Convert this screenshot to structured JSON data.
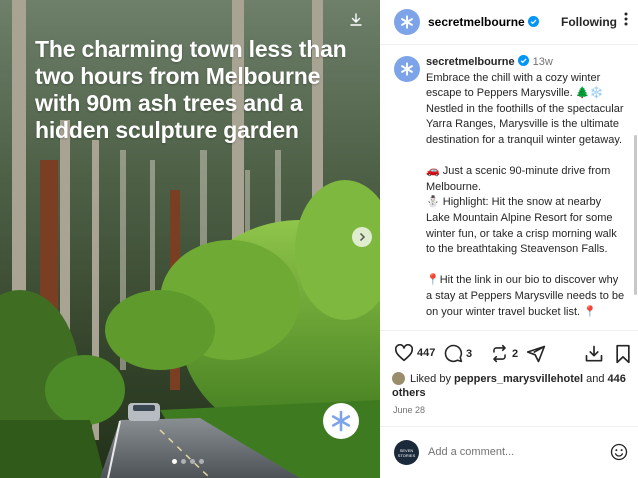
{
  "post": {
    "headline": "The charming town less than two hours from Melbourne with 90m ash trees and a hidden sculpture garden",
    "carousel_total": 4,
    "carousel_active": 1
  },
  "header": {
    "username": "secretmelbourne",
    "follow_label": "Following"
  },
  "caption": {
    "username": "secretmelbourne",
    "time": "13w",
    "paragraphs": [
      "Embrace the chill with a cozy winter escape to Peppers Marysville. 🌲❄️ Nestled in the foothills of the spectacular Yarra Ranges, Marysville is the ultimate destination for a tranquil winter getaway.",
      "🚗 Just a scenic 90-minute drive from Melbourne.\n⛄ Highlight: Hit the snow at nearby Lake Mountain Alpine Resort for some winter fun, or take a crisp morning walk to the breathtaking Steavenson Falls.",
      "📍Hit the link in our bio to discover why a stay at Peppers Marysville needs to be on your winter travel bucket list. 📍"
    ]
  },
  "actions": {
    "likes_count": "447",
    "comments_count": "3",
    "reposts_count": "2"
  },
  "likes": {
    "prefix": "Liked by",
    "user": "peppers_marysvillehotel",
    "joiner": "and",
    "others": "446 others"
  },
  "date": "June 28",
  "comment": {
    "placeholder": "Add a comment...",
    "avatar_text": "SEVEN\nSTORIES"
  },
  "colors": {
    "accent_avatar": "#7da4e8",
    "verified": "#0095f6"
  }
}
